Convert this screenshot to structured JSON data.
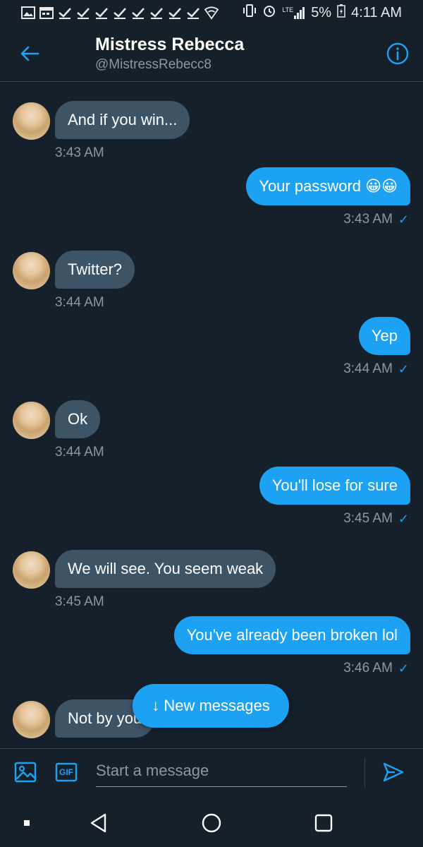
{
  "status_bar": {
    "battery": "5%",
    "time": "4:11 AM",
    "network": "LTE"
  },
  "header": {
    "title": "Mistress Rebecca",
    "handle": "@MistressRebecc8"
  },
  "messages": [
    {
      "dir": "in",
      "text": "And if you win...",
      "time": "3:43 AM"
    },
    {
      "dir": "out",
      "text": "Your password 😀😀",
      "time": "3:43 AM",
      "check": "✓"
    },
    {
      "dir": "in",
      "text": "Twitter?",
      "time": "3:44 AM"
    },
    {
      "dir": "out",
      "text": "Yep",
      "time": "3:44 AM",
      "check": "✓"
    },
    {
      "dir": "in",
      "text": "Ok",
      "time": "3:44 AM"
    },
    {
      "dir": "out",
      "text": "You'll lose for sure",
      "time": "3:45 AM",
      "check": "✓"
    },
    {
      "dir": "in",
      "text": "We will see. You seem weak",
      "time": "3:45 AM"
    },
    {
      "dir": "out",
      "text": "You've already been broken lol",
      "time": "3:46 AM",
      "check": "✓"
    },
    {
      "dir": "in",
      "text": "Not by you"
    }
  ],
  "new_messages_pill": "↓ New messages",
  "composer": {
    "placeholder": "Start a message",
    "gif_label": "GIF"
  },
  "colors": {
    "background": "#15202b",
    "accent": "#1da1f2",
    "incoming_bubble": "#3d5466",
    "secondary_text": "#8899a6"
  }
}
